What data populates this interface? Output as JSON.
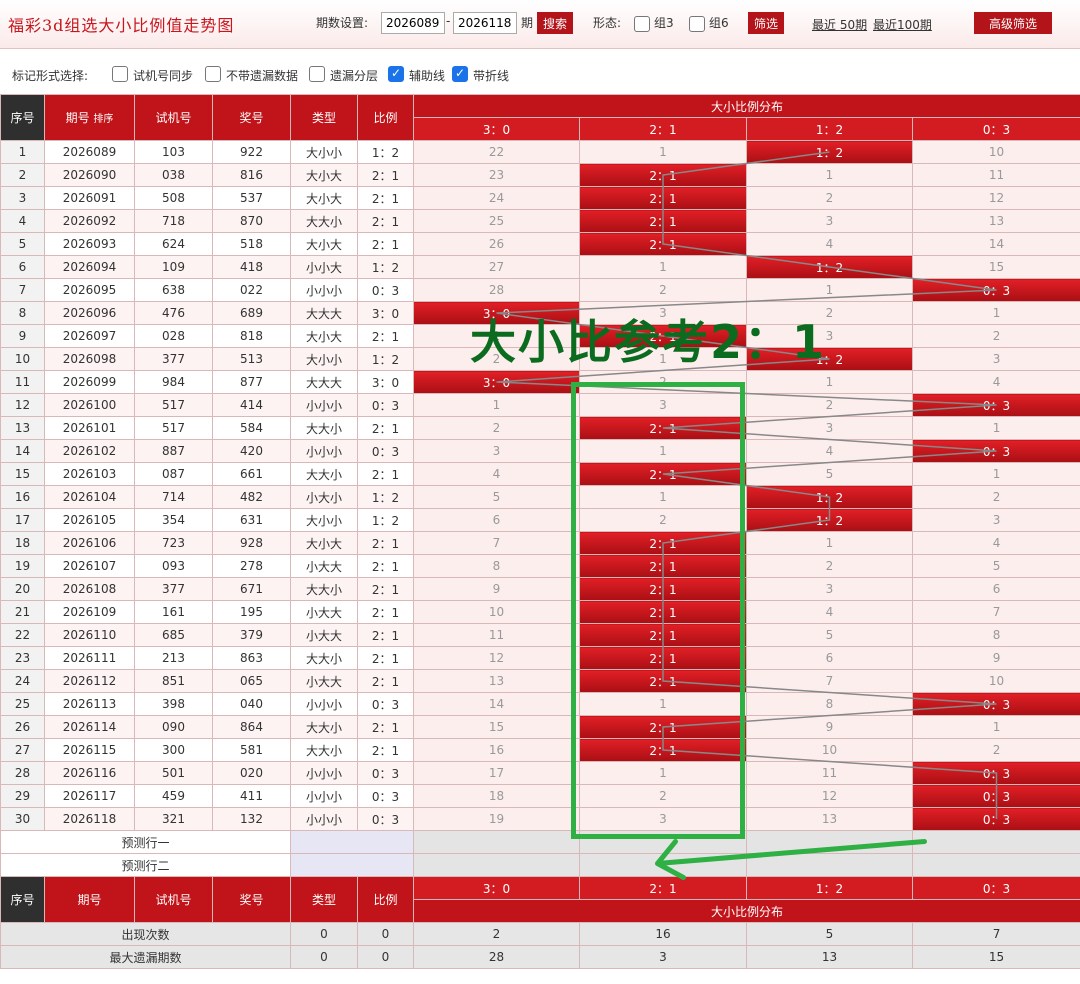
{
  "header": {
    "title": "福彩3d组选大小比例值走势图",
    "period_label": "期数设置:",
    "period_from": "2026089",
    "period_dash": "-",
    "period_to": "2026118",
    "period_suffix": "期",
    "search_label": "搜索",
    "shape_label": "形态:",
    "group3_label": "组3",
    "group6_label": "组6",
    "filter_label": "筛选",
    "recent50_label": "最近 50期",
    "recent100_label": "最近100期",
    "advanced_label": "高级筛选"
  },
  "options": {
    "label": "标记形式选择:",
    "items": [
      {
        "label": "试机号同步",
        "checked": false
      },
      {
        "label": "不带遗漏数据",
        "checked": false
      },
      {
        "label": "遗漏分层",
        "checked": false
      },
      {
        "label": "辅助线",
        "checked": true
      },
      {
        "label": "带折线",
        "checked": true
      }
    ]
  },
  "table": {
    "headers": {
      "seq": "序号",
      "period": "期号",
      "sort": "排序",
      "trial": "试机号",
      "award": "奖号",
      "type": "类型",
      "ratio": "比例",
      "dist": "大小比例分布"
    },
    "dist_cols": [
      "3：0",
      "2：1",
      "1：2",
      "0：3"
    ],
    "rows": [
      {
        "seq": "1",
        "period": "2026089",
        "trial": "103",
        "award": "922",
        "type": "大小小",
        "ratio": "1：2",
        "d": [
          "22",
          "1",
          "1：2",
          "10"
        ],
        "hit": 2
      },
      {
        "seq": "2",
        "period": "2026090",
        "trial": "038",
        "award": "816",
        "type": "大小大",
        "ratio": "2：1",
        "d": [
          "23",
          "2：1",
          "1",
          "11"
        ],
        "hit": 1
      },
      {
        "seq": "3",
        "period": "2026091",
        "trial": "508",
        "award": "537",
        "type": "大小大",
        "ratio": "2：1",
        "d": [
          "24",
          "2：1",
          "2",
          "12"
        ],
        "hit": 1
      },
      {
        "seq": "4",
        "period": "2026092",
        "trial": "718",
        "award": "870",
        "type": "大大小",
        "ratio": "2：1",
        "d": [
          "25",
          "2：1",
          "3",
          "13"
        ],
        "hit": 1
      },
      {
        "seq": "5",
        "period": "2026093",
        "trial": "624",
        "award": "518",
        "type": "大小大",
        "ratio": "2：1",
        "d": [
          "26",
          "2：1",
          "4",
          "14"
        ],
        "hit": 1
      },
      {
        "seq": "6",
        "period": "2026094",
        "trial": "109",
        "award": "418",
        "type": "小小大",
        "ratio": "1：2",
        "d": [
          "27",
          "1",
          "1：2",
          "15"
        ],
        "hit": 2
      },
      {
        "seq": "7",
        "period": "2026095",
        "trial": "638",
        "award": "022",
        "type": "小小小",
        "ratio": "0：3",
        "d": [
          "28",
          "2",
          "1",
          "0：3"
        ],
        "hit": 3
      },
      {
        "seq": "8",
        "period": "2026096",
        "trial": "476",
        "award": "689",
        "type": "大大大",
        "ratio": "3：0",
        "d": [
          "3：0",
          "3",
          "2",
          "1"
        ],
        "hit": 0
      },
      {
        "seq": "9",
        "period": "2026097",
        "trial": "028",
        "award": "818",
        "type": "大小大",
        "ratio": "2：1",
        "d": [
          "1",
          "2：1",
          "3",
          "2"
        ],
        "hit": 1
      },
      {
        "seq": "10",
        "period": "2026098",
        "trial": "377",
        "award": "513",
        "type": "大小小",
        "ratio": "1：2",
        "d": [
          "2",
          "1",
          "1：2",
          "3"
        ],
        "hit": 2
      },
      {
        "seq": "11",
        "period": "2026099",
        "trial": "984",
        "award": "877",
        "type": "大大大",
        "ratio": "3：0",
        "d": [
          "3：0",
          "2",
          "1",
          "4"
        ],
        "hit": 0
      },
      {
        "seq": "12",
        "period": "2026100",
        "trial": "517",
        "award": "414",
        "type": "小小小",
        "ratio": "0：3",
        "d": [
          "1",
          "3",
          "2",
          "0：3"
        ],
        "hit": 3
      },
      {
        "seq": "13",
        "period": "2026101",
        "trial": "517",
        "award": "584",
        "type": "大大小",
        "ratio": "2：1",
        "d": [
          "2",
          "2：1",
          "3",
          "1"
        ],
        "hit": 1
      },
      {
        "seq": "14",
        "period": "2026102",
        "trial": "887",
        "award": "420",
        "type": "小小小",
        "ratio": "0：3",
        "d": [
          "3",
          "1",
          "4",
          "0：3"
        ],
        "hit": 3
      },
      {
        "seq": "15",
        "period": "2026103",
        "trial": "087",
        "award": "661",
        "type": "大大小",
        "ratio": "2：1",
        "d": [
          "4",
          "2：1",
          "5",
          "1"
        ],
        "hit": 1
      },
      {
        "seq": "16",
        "period": "2026104",
        "trial": "714",
        "award": "482",
        "type": "小大小",
        "ratio": "1：2",
        "d": [
          "5",
          "1",
          "1：2",
          "2"
        ],
        "hit": 2
      },
      {
        "seq": "17",
        "period": "2026105",
        "trial": "354",
        "award": "631",
        "type": "大小小",
        "ratio": "1：2",
        "d": [
          "6",
          "2",
          "1：2",
          "3"
        ],
        "hit": 2
      },
      {
        "seq": "18",
        "period": "2026106",
        "trial": "723",
        "award": "928",
        "type": "大小大",
        "ratio": "2：1",
        "d": [
          "7",
          "2：1",
          "1",
          "4"
        ],
        "hit": 1
      },
      {
        "seq": "19",
        "period": "2026107",
        "trial": "093",
        "award": "278",
        "type": "小大大",
        "ratio": "2：1",
        "d": [
          "8",
          "2：1",
          "2",
          "5"
        ],
        "hit": 1
      },
      {
        "seq": "20",
        "period": "2026108",
        "trial": "377",
        "award": "671",
        "type": "大大小",
        "ratio": "2：1",
        "d": [
          "9",
          "2：1",
          "3",
          "6"
        ],
        "hit": 1
      },
      {
        "seq": "21",
        "period": "2026109",
        "trial": "161",
        "award": "195",
        "type": "小大大",
        "ratio": "2：1",
        "d": [
          "10",
          "2：1",
          "4",
          "7"
        ],
        "hit": 1
      },
      {
        "seq": "22",
        "period": "2026110",
        "trial": "685",
        "award": "379",
        "type": "小大大",
        "ratio": "2：1",
        "d": [
          "11",
          "2：1",
          "5",
          "8"
        ],
        "hit": 1
      },
      {
        "seq": "23",
        "period": "2026111",
        "trial": "213",
        "award": "863",
        "type": "大大小",
        "ratio": "2：1",
        "d": [
          "12",
          "2：1",
          "6",
          "9"
        ],
        "hit": 1
      },
      {
        "seq": "24",
        "period": "2026112",
        "trial": "851",
        "award": "065",
        "type": "小大大",
        "ratio": "2：1",
        "d": [
          "13",
          "2：1",
          "7",
          "10"
        ],
        "hit": 1
      },
      {
        "seq": "25",
        "period": "2026113",
        "trial": "398",
        "award": "040",
        "type": "小小小",
        "ratio": "0：3",
        "d": [
          "14",
          "1",
          "8",
          "0：3"
        ],
        "hit": 3
      },
      {
        "seq": "26",
        "period": "2026114",
        "trial": "090",
        "award": "864",
        "type": "大大小",
        "ratio": "2：1",
        "d": [
          "15",
          "2：1",
          "9",
          "1"
        ],
        "hit": 1
      },
      {
        "seq": "27",
        "period": "2026115",
        "trial": "300",
        "award": "581",
        "type": "大大小",
        "ratio": "2：1",
        "d": [
          "16",
          "2：1",
          "10",
          "2"
        ],
        "hit": 1
      },
      {
        "seq": "28",
        "period": "2026116",
        "trial": "501",
        "award": "020",
        "type": "小小小",
        "ratio": "0：3",
        "d": [
          "17",
          "1",
          "11",
          "0：3"
        ],
        "hit": 3
      },
      {
        "seq": "29",
        "period": "2026117",
        "trial": "459",
        "award": "411",
        "type": "小小小",
        "ratio": "0：3",
        "d": [
          "18",
          "2",
          "12",
          "0：3"
        ],
        "hit": 3
      },
      {
        "seq": "30",
        "period": "2026118",
        "trial": "321",
        "award": "132",
        "type": "小小小",
        "ratio": "0：3",
        "d": [
          "19",
          "3",
          "13",
          "0：3"
        ],
        "hit": 3
      }
    ],
    "predict1": "预测行一",
    "predict2": "预测行二",
    "stats": [
      {
        "label": "出现次数",
        "type": "0",
        "ratio": "0",
        "d": [
          "2",
          "16",
          "5",
          "7"
        ]
      },
      {
        "label": "最大遗漏期数",
        "type": "0",
        "ratio": "0",
        "d": [
          "28",
          "3",
          "13",
          "15"
        ]
      }
    ]
  },
  "annotation": {
    "text": "大小比参考2：1"
  },
  "colors": {
    "brand_red": "#c0141a",
    "hit_red": "#d8181e",
    "annotation_green": "#2fb044",
    "line_grey": "#888888"
  }
}
